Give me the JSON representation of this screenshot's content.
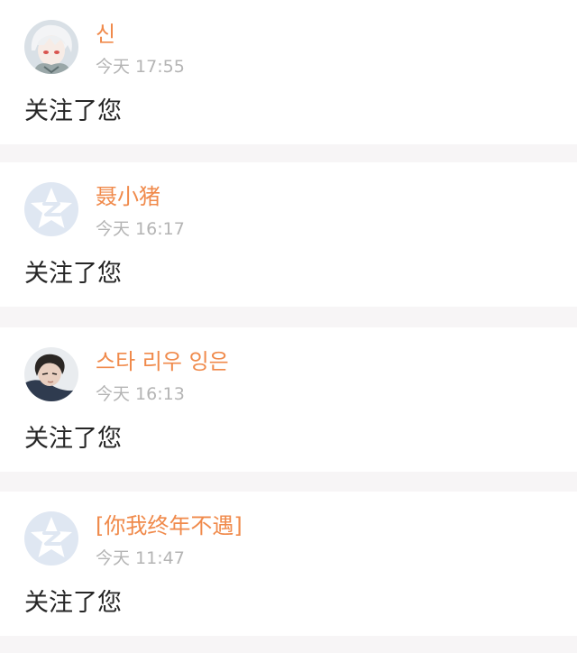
{
  "notifications": [
    {
      "username": "신",
      "time": "今天 17:55",
      "message": "关注了您",
      "avatar_icon": "anime-avatar-white-hair"
    },
    {
      "username": "聂小猪",
      "time": "今天 16:17",
      "message": "关注了您",
      "avatar_icon": "default-qzone-star-avatar"
    },
    {
      "username": "스타 리우 잉은",
      "time": "今天 16:13",
      "message": "关注了您",
      "avatar_icon": "photo-avatar-person"
    },
    {
      "username": "[你我终年不遇]",
      "time": "今天 11:47",
      "message": "关注了您",
      "avatar_icon": "default-qzone-star-avatar"
    }
  ],
  "colors": {
    "username": "#f08a4b",
    "timestamp": "#b4b4b4",
    "message": "#262626",
    "card_background": "#ffffff",
    "separator": "#f7f5f6",
    "default_avatar_bg": "#dfe7f2"
  }
}
